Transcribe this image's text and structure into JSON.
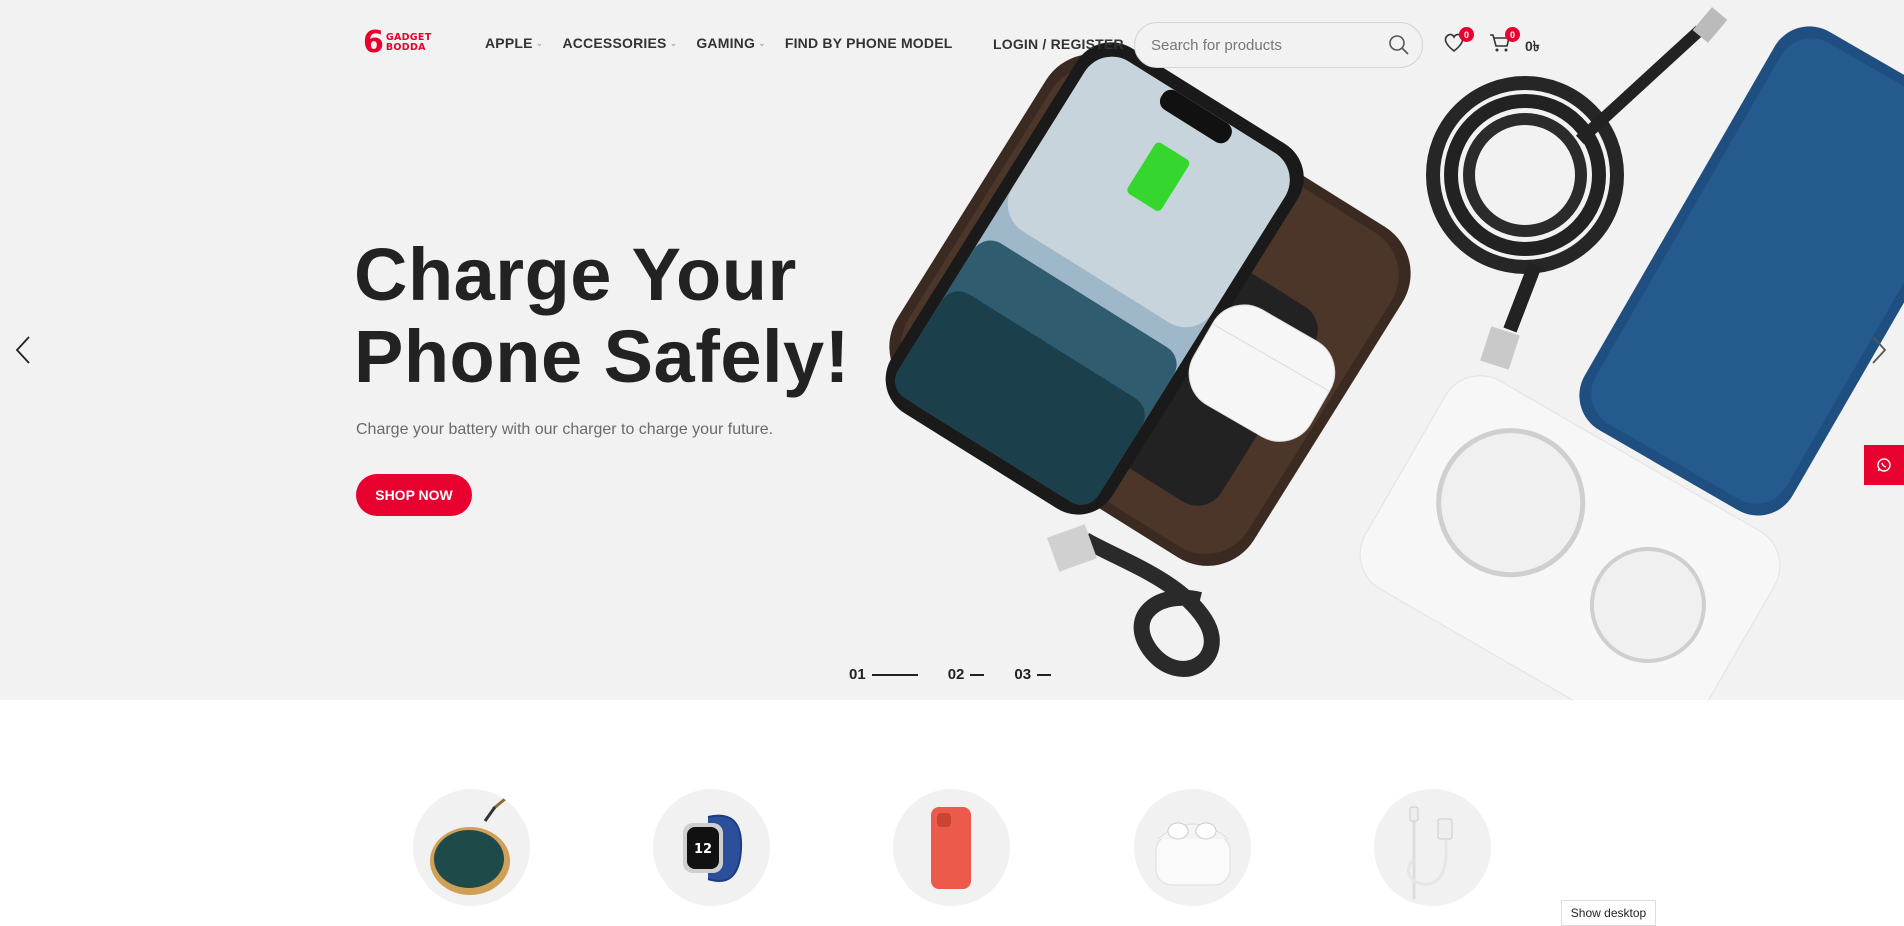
{
  "brand": {
    "digit": "6",
    "line1": "GADGET",
    "line2": "BODDA"
  },
  "nav": [
    {
      "label": "APPLE",
      "has_dropdown": true
    },
    {
      "label": "ACCESSORIES",
      "has_dropdown": true
    },
    {
      "label": "GAMING",
      "has_dropdown": true
    },
    {
      "label": "FIND BY PHONE MODEL",
      "has_dropdown": false
    }
  ],
  "header": {
    "login_label": "LOGIN / REGISTER",
    "search_placeholder": "Search for products",
    "wishlist_count": "0",
    "cart_count": "0",
    "cart_total": "0৳"
  },
  "hero": {
    "title_line1": "Charge Your",
    "title_line2": "Phone Safely!",
    "subtitle": "Charge your battery with our charger to charge your future.",
    "cta_label": "SHOP NOW",
    "slides": [
      {
        "label": "01",
        "active": true
      },
      {
        "label": "02",
        "active": false
      },
      {
        "label": "03",
        "active": false
      }
    ]
  },
  "categories": [
    {
      "icon": "wireless-charger"
    },
    {
      "icon": "apple-watch"
    },
    {
      "icon": "phone-case"
    },
    {
      "icon": "airpods"
    },
    {
      "icon": "lightning-cable"
    }
  ],
  "footer_button": "Show desktop",
  "colors": {
    "accent": "#e8002f",
    "hero_bg": "#f2f2f2",
    "text_dark": "#222222"
  }
}
